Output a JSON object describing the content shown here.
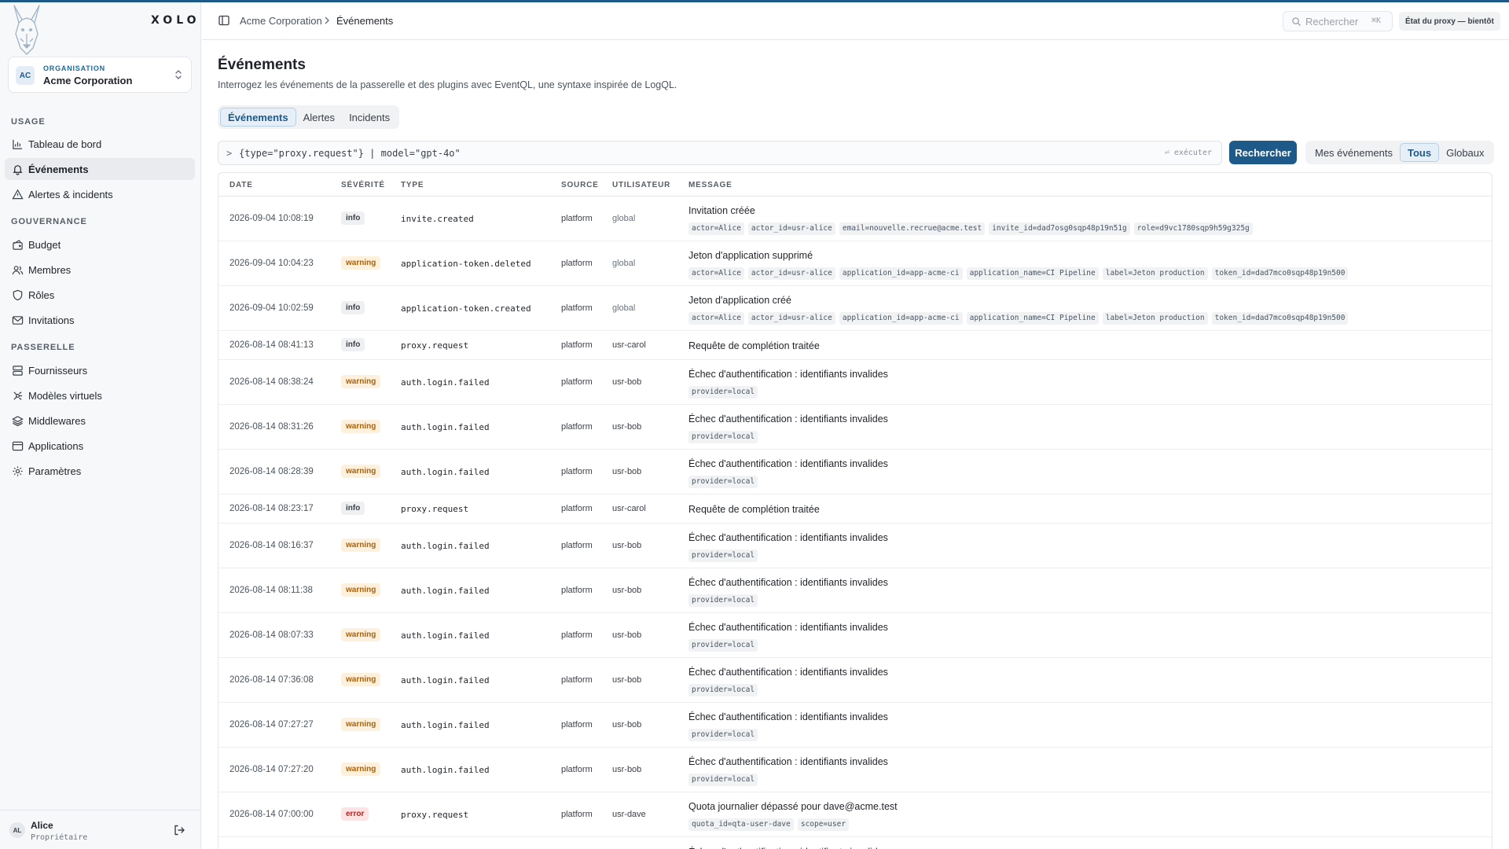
{
  "brand": "XOLO",
  "org": {
    "label": "ORGANISATION",
    "name": "Acme Corporation",
    "initials": "AC"
  },
  "nav": {
    "sections": [
      {
        "title": "USAGE",
        "items": [
          {
            "label": "Tableau de bord",
            "icon": "bar-chart-icon"
          },
          {
            "label": "Événements",
            "icon": "bell-icon",
            "active": true
          },
          {
            "label": "Alertes & incidents",
            "icon": "alert-triangle-icon"
          }
        ]
      },
      {
        "title": "GOUVERNANCE",
        "items": [
          {
            "label": "Budget",
            "icon": "wallet-icon"
          },
          {
            "label": "Membres",
            "icon": "users-icon"
          },
          {
            "label": "Rôles",
            "icon": "shield-icon"
          },
          {
            "label": "Invitations",
            "icon": "mail-icon"
          }
        ]
      },
      {
        "title": "PASSERELLE",
        "items": [
          {
            "label": "Fournisseurs",
            "icon": "server-icon"
          },
          {
            "label": "Modèles virtuels",
            "icon": "cpu-icon"
          },
          {
            "label": "Middlewares",
            "icon": "layers-icon"
          },
          {
            "label": "Applications",
            "icon": "app-window-icon"
          },
          {
            "label": "Paramètres",
            "icon": "gear-icon"
          }
        ]
      }
    ]
  },
  "user": {
    "name": "Alice",
    "role": "Propriétaire",
    "initials": "AL"
  },
  "header": {
    "breadcrumb": [
      "Acme Corporation",
      "Événements"
    ],
    "search_placeholder": "Rechercher",
    "search_shortcut": "⌘K",
    "proxy_state": "État du proxy — bientôt"
  },
  "page": {
    "title": "Événements",
    "subtitle": "Interrogez les événements de la passerelle et des plugins avec EventQL, une syntaxe inspirée de LogQL.",
    "tabs": [
      "Événements",
      "Alertes",
      "Incidents"
    ],
    "active_tab": 0,
    "query_prompt": ">",
    "query": "{type=\"proxy.request\"} | model=\"gpt-4o\"",
    "run_hint": "⏎ exécuter",
    "search_button": "Rechercher",
    "scope_options": [
      "Mes événements",
      "Tous",
      "Globaux"
    ],
    "active_scope": 1
  },
  "table": {
    "columns": [
      "DATE",
      "SÉVÉRITÉ",
      "TYPE",
      "SOURCE",
      "UTILISATEUR",
      "MESSAGE"
    ],
    "rows": [
      {
        "date": "2026-09-04 10:08:19",
        "severity": "info",
        "type": "invite.created",
        "source": "platform",
        "user": "global",
        "message": "Invitation créée",
        "tags": [
          "actor=Alice",
          "actor_id=usr-alice",
          "email=nouvelle.recrue@acme.test",
          "invite_id=dad7osg0sqp48p19n51g",
          "role=d9vc1780sqp9h59g325g"
        ]
      },
      {
        "date": "2026-09-04 10:04:23",
        "severity": "warning",
        "type": "application-token.deleted",
        "source": "platform",
        "user": "global",
        "message": "Jeton d'application supprimé",
        "tags": [
          "actor=Alice",
          "actor_id=usr-alice",
          "application_id=app-acme-ci",
          "application_name=CI Pipeline",
          "label=Jeton production",
          "token_id=dad7mco0sqp48p19n500"
        ]
      },
      {
        "date": "2026-09-04 10:02:59",
        "severity": "info",
        "type": "application-token.created",
        "source": "platform",
        "user": "global",
        "message": "Jeton d'application créé",
        "tags": [
          "actor=Alice",
          "actor_id=usr-alice",
          "application_id=app-acme-ci",
          "application_name=CI Pipeline",
          "label=Jeton production",
          "token_id=dad7mco0sqp48p19n500"
        ]
      },
      {
        "date": "2026-08-14 08:41:13",
        "severity": "info",
        "type": "proxy.request",
        "source": "platform",
        "user": "usr-carol",
        "message": "Requête de complétion traitée",
        "tags": []
      },
      {
        "date": "2026-08-14 08:38:24",
        "severity": "warning",
        "type": "auth.login.failed",
        "source": "platform",
        "user": "usr-bob",
        "message": "Échec d'authentification : identifiants invalides",
        "tags": [
          "provider=local"
        ]
      },
      {
        "date": "2026-08-14 08:31:26",
        "severity": "warning",
        "type": "auth.login.failed",
        "source": "platform",
        "user": "usr-bob",
        "message": "Échec d'authentification : identifiants invalides",
        "tags": [
          "provider=local"
        ]
      },
      {
        "date": "2026-08-14 08:28:39",
        "severity": "warning",
        "type": "auth.login.failed",
        "source": "platform",
        "user": "usr-bob",
        "message": "Échec d'authentification : identifiants invalides",
        "tags": [
          "provider=local"
        ]
      },
      {
        "date": "2026-08-14 08:23:17",
        "severity": "info",
        "type": "proxy.request",
        "source": "platform",
        "user": "usr-carol",
        "message": "Requête de complétion traitée",
        "tags": []
      },
      {
        "date": "2026-08-14 08:16:37",
        "severity": "warning",
        "type": "auth.login.failed",
        "source": "platform",
        "user": "usr-bob",
        "message": "Échec d'authentification : identifiants invalides",
        "tags": [
          "provider=local"
        ]
      },
      {
        "date": "2026-08-14 08:11:38",
        "severity": "warning",
        "type": "auth.login.failed",
        "source": "platform",
        "user": "usr-bob",
        "message": "Échec d'authentification : identifiants invalides",
        "tags": [
          "provider=local"
        ]
      },
      {
        "date": "2026-08-14 08:07:33",
        "severity": "warning",
        "type": "auth.login.failed",
        "source": "platform",
        "user": "usr-bob",
        "message": "Échec d'authentification : identifiants invalides",
        "tags": [
          "provider=local"
        ]
      },
      {
        "date": "2026-08-14 07:36:08",
        "severity": "warning",
        "type": "auth.login.failed",
        "source": "platform",
        "user": "usr-bob",
        "message": "Échec d'authentification : identifiants invalides",
        "tags": [
          "provider=local"
        ]
      },
      {
        "date": "2026-08-14 07:27:27",
        "severity": "warning",
        "type": "auth.login.failed",
        "source": "platform",
        "user": "usr-bob",
        "message": "Échec d'authentification : identifiants invalides",
        "tags": [
          "provider=local"
        ]
      },
      {
        "date": "2026-08-14 07:27:20",
        "severity": "warning",
        "type": "auth.login.failed",
        "source": "platform",
        "user": "usr-bob",
        "message": "Échec d'authentification : identifiants invalides",
        "tags": [
          "provider=local"
        ]
      },
      {
        "date": "2026-08-14 07:00:00",
        "severity": "error",
        "type": "proxy.request",
        "source": "platform",
        "user": "usr-dave",
        "message": "Quota journalier dépassé pour dave@acme.test",
        "tags": [
          "quota_id=qta-user-dave",
          "scope=user"
        ]
      },
      {
        "date": "",
        "severity": "",
        "type": "",
        "source": "",
        "user": "",
        "message": "Échec d'authentification : identifiants invalides",
        "tags": []
      }
    ]
  }
}
